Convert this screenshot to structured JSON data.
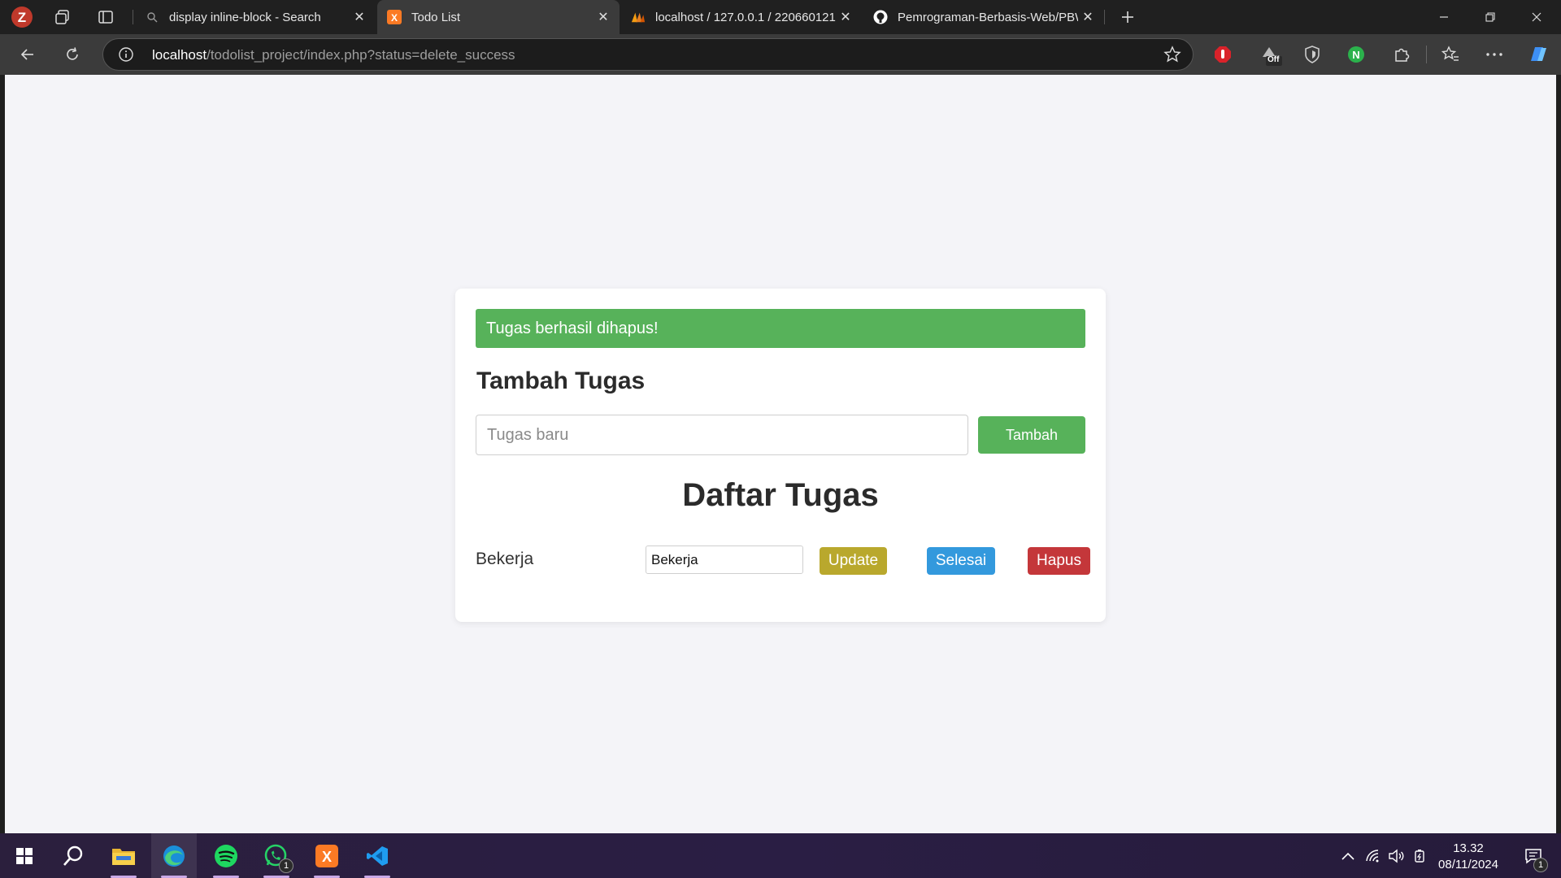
{
  "browser": {
    "tabs": [
      {
        "title": "display inline-block - Search"
      },
      {
        "title": "Todo List"
      },
      {
        "title": "localhost / 127.0.0.1 / 220660121"
      },
      {
        "title": "Pemrograman-Berbasis-Web/PBW"
      }
    ],
    "url_host": "localhost",
    "url_rest": "/todolist_project/index.php?status=delete_success",
    "ext_badge": "Off"
  },
  "page": {
    "alert": "Tugas berhasil dihapus!",
    "add_heading": "Tambah Tugas",
    "input_placeholder": "Tugas baru",
    "add_button": "Tambah",
    "list_heading": "Daftar Tugas",
    "tasks": [
      {
        "label": "Bekerja",
        "edit_value": "Bekerja",
        "update": "Update",
        "done": "Selesai",
        "delete": "Hapus"
      }
    ]
  },
  "taskbar": {
    "time": "13.32",
    "date": "08/11/2024",
    "whatsapp_badge": "1",
    "notification_badge": "1"
  },
  "colors": {
    "success": "#57b25a",
    "update": "#b9a82d",
    "done": "#3399dd",
    "delete": "#c4373a"
  }
}
